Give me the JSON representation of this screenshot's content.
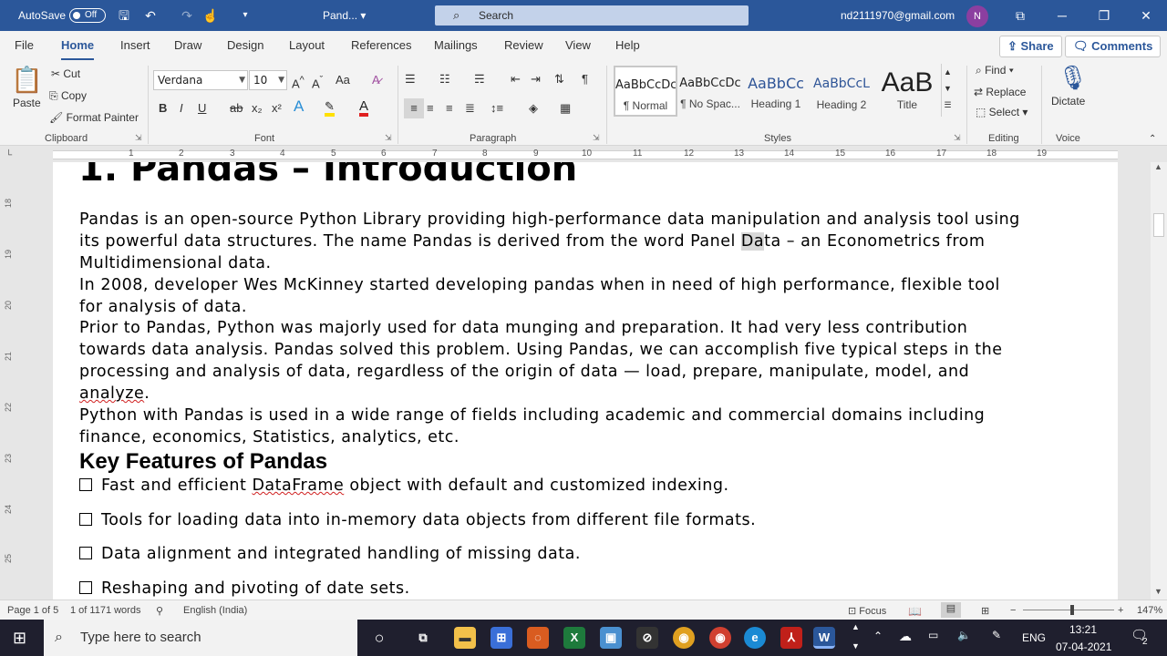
{
  "titlebar": {
    "autosave_label": "AutoSave",
    "autosave_state": "Off",
    "doc_title": "Pand...",
    "search_placeholder": "Search",
    "account": "nd2111970@gmail.com",
    "avatar_initial": "N"
  },
  "tabs": [
    "File",
    "Home",
    "Insert",
    "Draw",
    "Design",
    "Layout",
    "References",
    "Mailings",
    "Review",
    "View",
    "Help"
  ],
  "share": {
    "share_label": "Share",
    "comments_label": "Comments"
  },
  "ribbon": {
    "clipboard": {
      "paste": "Paste",
      "cut": "Cut",
      "copy": "Copy",
      "format_painter": "Format Painter",
      "group": "Clipboard"
    },
    "font": {
      "family": "Verdana",
      "size": "10",
      "group": "Font",
      "bold": "B",
      "italic": "I",
      "underline": "U",
      "strike": "ab",
      "sub": "x₂",
      "sup": "x²",
      "grow": "A^",
      "shrink": "A˅",
      "case": "Aa"
    },
    "paragraph": {
      "group": "Paragraph"
    },
    "styles": {
      "group": "Styles",
      "items": [
        {
          "preview": "AaBbCcDc",
          "label": "¶ Normal"
        },
        {
          "preview": "AaBbCcDc",
          "label": "¶ No Spac..."
        },
        {
          "preview": "AaBbCc",
          "label": "Heading 1"
        },
        {
          "preview": "AaBbCcL",
          "label": "Heading 2"
        },
        {
          "preview": "AaB",
          "label": "Title"
        }
      ]
    },
    "editing": {
      "find": "Find",
      "replace": "Replace",
      "select": "Select",
      "group": "Editing"
    },
    "voice": {
      "dictate": "Dictate",
      "group": "Voice"
    }
  },
  "ruler": [
    "1",
    "2",
    "3",
    "4",
    "5",
    "6",
    "7",
    "8",
    "9",
    "10",
    "11",
    "12",
    "13",
    "14",
    "15",
    "16",
    "17",
    "18",
    "19"
  ],
  "vruler": [
    "18",
    "19",
    "20",
    "21",
    "22",
    "23",
    "24",
    "25"
  ],
  "document": {
    "heading": "1. Pandas – Introduction",
    "p1_l1": "Pandas is an open-source Python Library providing high-performance data manipulation and analysis tool using",
    "p1_l2a": "its powerful data structures. The name Pandas is derived from the word Panel ",
    "p1_l2b": "Da",
    "p1_l2c": "ta – an Econometrics from",
    "p1_l3": "Multidimensional data.",
    "p2_l1": "In 2008, developer Wes McKinney started developing pandas when in need of high performance, flexible tool",
    "p2_l2": "for analysis of data.",
    "p3_l1": "Prior to Pandas, Python was majorly used for data munging and preparation. It had very less contribution",
    "p3_l2": "towards data analysis. Pandas solved this problem. Using Pandas, we can accomplish five typical steps in the",
    "p3_l3": "processing and analysis of data, regardless of the origin of data — load, prepare, manipulate, model, and",
    "p3_l4": "analyze",
    "p3_l4b": ".",
    "p4_l1": "Python with Pandas is used in a wide range of fields including academic and commercial domains including",
    "p4_l2": "finance, economics, Statistics, analytics, etc.",
    "h2": "Key Features of Pandas",
    "b1a": "Fast and efficient ",
    "b1b": "DataFrame",
    "b1c": " object with default and customized indexing.",
    "b2": "Tools for loading data into in-memory data objects from different file formats.",
    "b3": "Data alignment and integrated handling of missing data.",
    "b4": "Reshaping and pivoting of date sets."
  },
  "status": {
    "page": "Page 1 of 5",
    "words": "1 of 1171 words",
    "language": "English (India)",
    "focus": "Focus",
    "zoom": "147%"
  },
  "taskbar": {
    "search_placeholder": "Type here to search",
    "lang": "ENG",
    "time": "13:21",
    "date": "07-04-2021",
    "notif_count": "2"
  }
}
